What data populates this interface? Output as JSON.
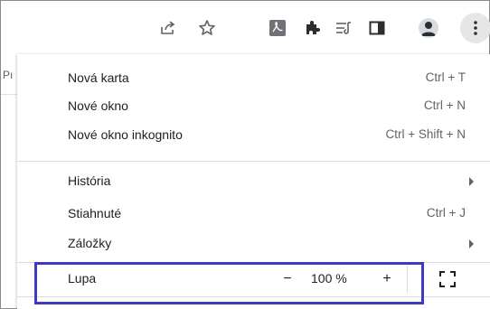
{
  "toolbar": {
    "icons": [
      "share-icon",
      "star-icon",
      "pdf-extension-icon",
      "extensions-icon",
      "reading-list-icon",
      "side-panel-icon",
      "profile-avatar",
      "more-menu-icon"
    ]
  },
  "page": {
    "hint": "Pı"
  },
  "menu": {
    "items": [
      {
        "label": "Nová karta",
        "shortcut": "Ctrl + T"
      },
      {
        "label": "Nové okno",
        "shortcut": "Ctrl + N"
      },
      {
        "label": "Nové okno inkognito",
        "shortcut": "Ctrl + Shift + N"
      },
      {
        "label": "História",
        "shortcut": ""
      },
      {
        "label": "Stiahnuté",
        "shortcut": "Ctrl + J"
      },
      {
        "label": "Záložky",
        "shortcut": ""
      }
    ],
    "zoom": {
      "label": "Lupa",
      "minus": "−",
      "value": "100 %",
      "plus": "+"
    }
  },
  "colors": {
    "highlight": "#3c3cc0",
    "menu_bg": "#ffffff",
    "separator": "#dadce0"
  }
}
